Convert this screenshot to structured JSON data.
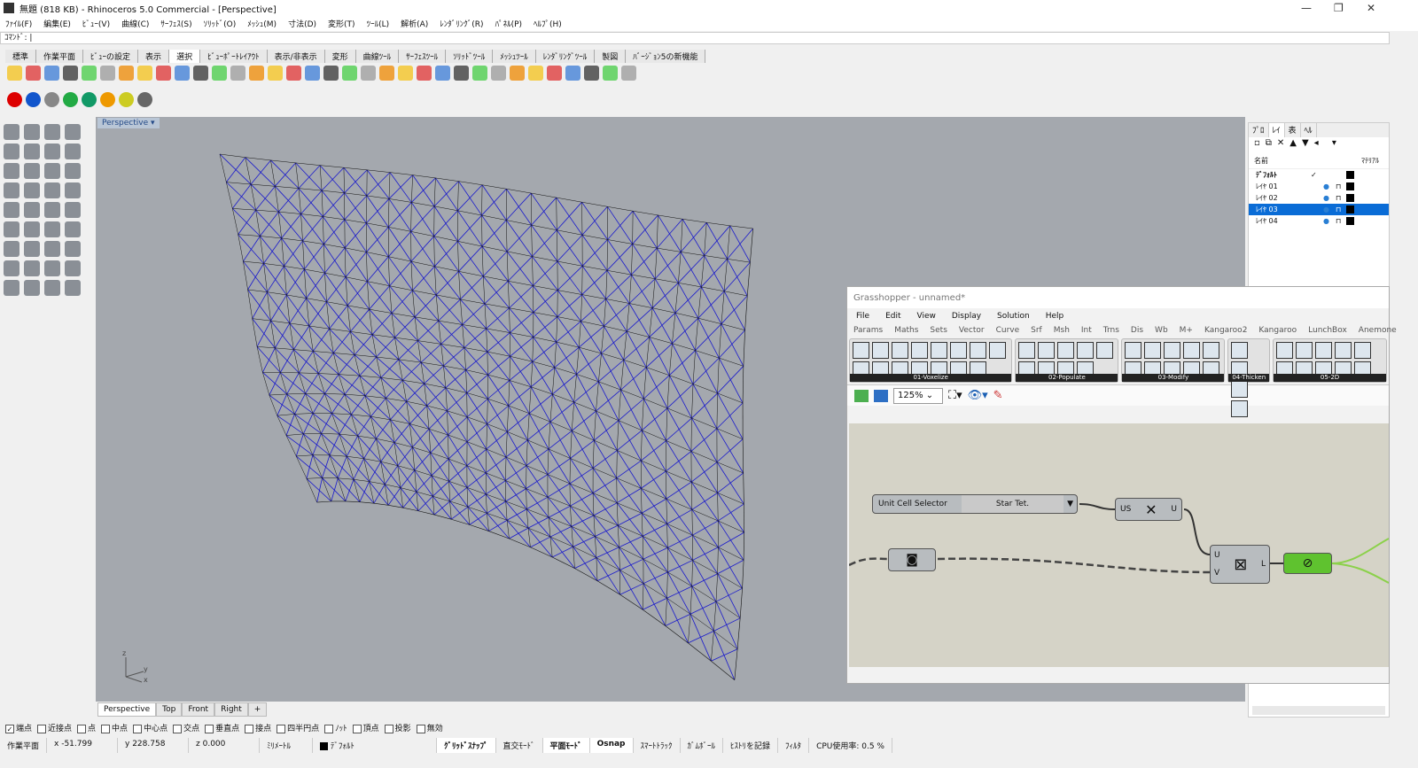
{
  "title": "無題 (818 KB) - Rhinoceros 5.0 Commercial - [Perspective]",
  "menu": [
    "ﾌｧｲﾙ(F)",
    "編集(E)",
    "ﾋﾞｭｰ(V)",
    "曲線(C)",
    "ｻｰﾌｪｽ(S)",
    "ｿﾘｯﾄﾞ(O)",
    "ﾒｯｼｭ(M)",
    "寸法(D)",
    "変形(T)",
    "ﾂｰﾙ(L)",
    "解析(A)",
    "ﾚﾝﾀﾞﾘﾝｸﾞ(R)",
    "ﾊﾟﾈﾙ(P)",
    "ﾍﾙﾌﾟ(H)"
  ],
  "command_label": "ｺﾏﾝﾄﾞ:",
  "toolbar_tabs": [
    "標準",
    "作業平面",
    "ﾋﾞｭｰの設定",
    "表示",
    "選択",
    "ﾋﾞｭｰﾎﾟｰﾄﾚｲｱｳﾄ",
    "表示/非表示",
    "変形",
    "曲線ﾂｰﾙ",
    "ｻｰﾌｪｽﾂｰﾙ",
    "ｿﾘｯﾄﾞﾂｰﾙ",
    "ﾒｯｼｭﾂｰﾙ",
    "ﾚﾝﾀﾞﾘﾝｸﾞﾂｰﾙ",
    "製図",
    "ﾊﾞｰｼﾞｮﾝ5の新機能"
  ],
  "active_toolbar_tab": "選択",
  "viewport": {
    "label": "Perspective",
    "tabs": [
      "Perspective",
      "Top",
      "Front",
      "Right"
    ],
    "active": "Perspective",
    "axes": {
      "z": "z",
      "y": "y",
      "x": "x"
    }
  },
  "panel": {
    "tabs": [
      "ﾌﾟﾛ",
      "ﾚｲ",
      "表",
      "ﾍﾙ"
    ],
    "header_name": "名前",
    "header_material": "ﾏﾃﾘｱﾙ",
    "layers": [
      {
        "name": "ﾃﾞﾌｫﾙﾄ",
        "current": "✓"
      },
      {
        "name": "ﾚｲﾔ 01"
      },
      {
        "name": "ﾚｲﾔ 02"
      },
      {
        "name": "ﾚｲﾔ 03",
        "selected": true
      },
      {
        "name": "ﾚｲﾔ 04"
      }
    ]
  },
  "osnap": [
    {
      "label": "端点",
      "checked": true
    },
    {
      "label": "近接点"
    },
    {
      "label": "点"
    },
    {
      "label": "中点"
    },
    {
      "label": "中心点"
    },
    {
      "label": "交点"
    },
    {
      "label": "垂直点"
    },
    {
      "label": "接点"
    },
    {
      "label": "四半円点"
    },
    {
      "label": "ﾉｯﾄ"
    },
    {
      "label": "頂点"
    },
    {
      "label": "投影"
    },
    {
      "label": "無効"
    }
  ],
  "status": {
    "cplane": "作業平面",
    "x": "x -51.799",
    "y": "y 228.758",
    "z": "z 0.000",
    "units": "ﾐﾘﾒｰﾄﾙ",
    "layer": "ﾃﾞﾌｫﾙﾄ",
    "grid_snap": "ｸﾞﾘｯﾄﾞｽﾅｯﾌﾟ",
    "ortho": "直交ﾓｰﾄﾞ",
    "planar": "平面ﾓｰﾄﾞ",
    "osnap": "Osnap",
    "smarttrack": "ｽﾏｰﾄﾄﾗｯｸ",
    "gumball": "ｶﾞﾑﾎﾞｰﾙ",
    "history": "ﾋｽﾄﾘを記録",
    "filter": "ﾌｨﾙﾀ",
    "cpu": "CPU使用率: 0.5 %"
  },
  "grasshopper": {
    "title": "Grasshopper - unnamed*",
    "menu": [
      "File",
      "Edit",
      "View",
      "Display",
      "Solution",
      "Help"
    ],
    "tabs": [
      "Params",
      "Maths",
      "Sets",
      "Vector",
      "Curve",
      "Srf",
      "Msh",
      "Int",
      "Trns",
      "Dis",
      "Wb",
      "M+",
      "Kangaroo2",
      "Kangaroo",
      "LunchBox",
      "Anemone"
    ],
    "groups": [
      "01-Voxelize",
      "02-Populate",
      "03-Modify",
      "04-Thicken",
      "05-2D"
    ],
    "zoom": "125%",
    "nodes": {
      "selector_label": "Unit Cell Selector",
      "selector_value": "Star Tet.",
      "cross_in": "US",
      "cross_out": "U",
      "grid_in_u": "U",
      "grid_in_v": "V",
      "grid_out": "L"
    }
  },
  "colors": {
    "mesh_blue": "#1a1acc",
    "mesh_black": "#111111",
    "selection": "#0a6cd6"
  }
}
